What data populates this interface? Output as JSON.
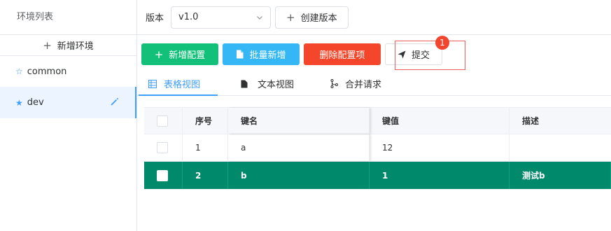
{
  "sidebar": {
    "title": "环境列表",
    "add_label": "新增环境",
    "environments": [
      {
        "name": "common"
      },
      {
        "name": "dev"
      }
    ]
  },
  "header": {
    "version_label": "版本",
    "version_value": "v1.0",
    "create_version_label": "创建版本"
  },
  "toolbar": {
    "add_config": "新增配置",
    "batch_add": "批量新增",
    "delete_config": "删除配置项",
    "submit": "提交",
    "badge_count": "1"
  },
  "tabs": [
    {
      "label": "表格视图"
    },
    {
      "label": "文本视图"
    },
    {
      "label": "合并请求"
    }
  ],
  "table": {
    "headers": [
      "序号",
      "键名",
      "键值",
      "描述"
    ],
    "rows": [
      {
        "index": "1",
        "key": "a",
        "value": "12",
        "desc": ""
      },
      {
        "index": "2",
        "key": "b",
        "value": "1",
        "desc": "测试b"
      }
    ]
  },
  "colors": {
    "accent": "#409eff",
    "green": "#13c07a",
    "blue": "#34b7f4",
    "red": "#f4462a",
    "selected_row": "#00896b"
  }
}
